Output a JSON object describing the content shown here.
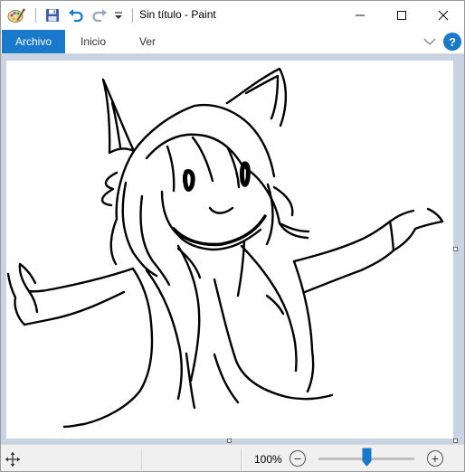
{
  "window": {
    "title": "Sin título - Paint"
  },
  "quick_access": {
    "app_icon": "paint-palette-icon",
    "save_icon": "floppy-disk-icon",
    "undo_icon": "undo-arrow-icon",
    "redo_icon": "redo-arrow-icon",
    "customize_icon": "dropdown-arrow-icon"
  },
  "ribbon": {
    "file_tab": "Archivo",
    "tabs": [
      "Inicio",
      "Ver"
    ],
    "help_label": "?"
  },
  "status": {
    "zoom_label": "100%",
    "zoom_level_percent": 100,
    "zoom_out_label": "−",
    "zoom_in_label": "+"
  },
  "colors": {
    "accent": "#1979ca",
    "workspace_bg": "#cad3e3",
    "canvas_bg": "#ffffff",
    "stroke": "#000000"
  }
}
